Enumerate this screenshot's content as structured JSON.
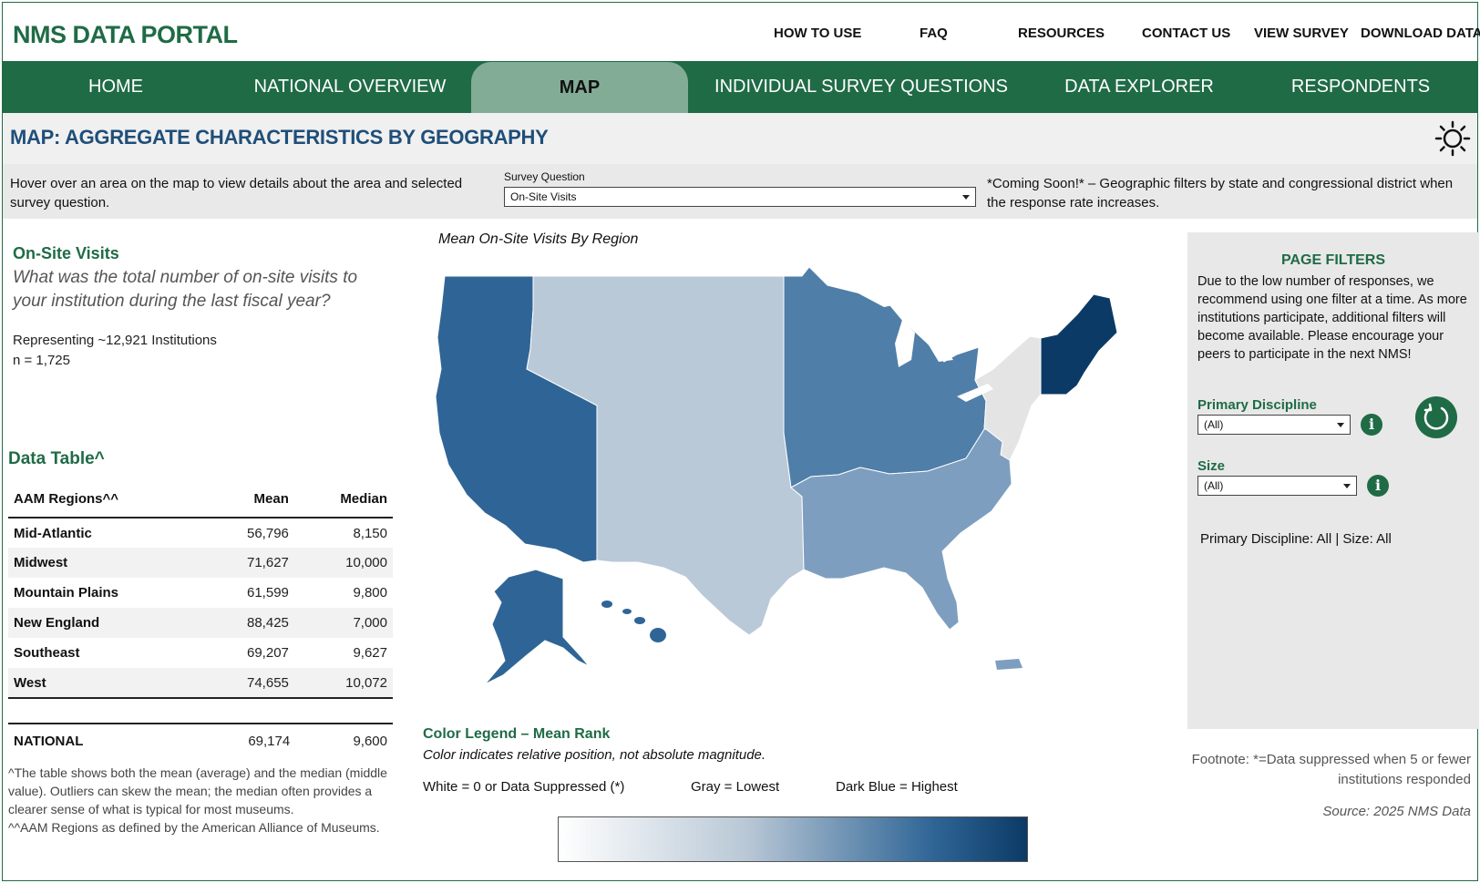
{
  "brand": "NMS DATA PORTAL",
  "top_links": [
    "HOW TO USE",
    "FAQ",
    "RESOURCES",
    "CONTACT US",
    "VIEW SURVEY",
    "DOWNLOAD DATA"
  ],
  "nav_tabs": [
    "HOME",
    "NATIONAL OVERVIEW",
    "MAP",
    "INDIVIDUAL SURVEY QUESTIONS",
    "DATA EXPLORER",
    "RESPONDENTS"
  ],
  "active_tab": "MAP",
  "page_title": "MAP: AGGREGATE CHARACTERISTICS BY GEOGRAPHY",
  "theme_icon": "sun-icon",
  "hover_text": "Hover over an area on the map to view details about the area and selected survey question.",
  "survey_question": {
    "label": "Survey Question",
    "value": "On-Site Visits"
  },
  "coming_soon": "*Coming Soon!* – Geographic filters by state and congressional district when the response rate increases.",
  "question": {
    "title": "On-Site Visits",
    "text": "What was the total number of on-site visits to your institution during the last fiscal year?",
    "representing": "Representing ~12,921 Institutions",
    "n": "n = 1,725"
  },
  "data_table": {
    "title": "Data Table^",
    "headers": [
      "AAM Regions^^",
      "Mean",
      "Median"
    ],
    "rows": [
      [
        "Mid-Atlantic",
        "56,796",
        "8,150"
      ],
      [
        "Midwest",
        "71,627",
        "10,000"
      ],
      [
        "Mountain Plains",
        "61,599",
        "9,800"
      ],
      [
        "New England",
        "88,425",
        "7,000"
      ],
      [
        "Southeast",
        "69,207",
        "9,627"
      ],
      [
        "West",
        "74,655",
        "10,072"
      ]
    ],
    "national": [
      "NATIONAL",
      "69,174",
      "9,600"
    ],
    "footnote_1": "^The table shows both the mean (average) and the median (middle value). Outliers can skew the mean; the median often provides a clearer sense of what is typical for most museums.",
    "footnote_2": "^^AAM Regions as defined by the American Alliance of Museums."
  },
  "map": {
    "title": "Mean On-Site Visits By Region",
    "region_colors": {
      "West": "#2f6596",
      "Mountain Plains": "#b9c9d8",
      "Midwest": "#4f7ea8",
      "Southeast": "#7d9ebf",
      "Mid-Atlantic": "#e4e4e4",
      "New England": "#0c3a66"
    }
  },
  "legend": {
    "title": "Color Legend – Mean Rank",
    "subtitle": "Color indicates relative position, not absolute magnitude.",
    "white": "White = 0 or Data Suppressed (*)",
    "gray": "Gray = Lowest",
    "dark": "Dark Blue = Highest"
  },
  "filters": {
    "title": "PAGE FILTERS",
    "description": "Due to the low number of responses, we recommend using one filter at a time. As more institutions participate, additional filters will become available. Please encourage your peers to participate in the next NMS!",
    "primary_discipline_label": "Primary Discipline",
    "primary_discipline_value": "(All)",
    "size_label": "Size",
    "size_value": "(All)",
    "summary": "Primary Discipline: All | Size: All",
    "reset_icon": "reset-icon",
    "info_icon": "info-icon"
  },
  "footnote": "Footnote: *=Data suppressed when 5 or fewer institutions responded",
  "source": "Source: 2025 NMS Data",
  "colors": {
    "brand_green": "#1f6b46",
    "title_blue": "#1f4e79",
    "active_tab": "#83ac97"
  }
}
